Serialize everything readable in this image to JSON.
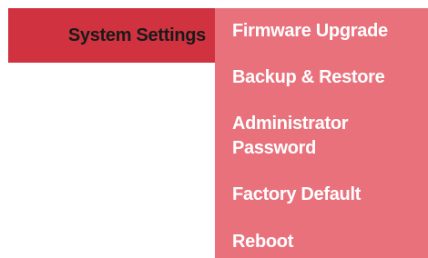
{
  "menu": {
    "main_item": "System Settings",
    "submenu": [
      {
        "label": "Firmware Upgrade"
      },
      {
        "label": "Backup & Restore"
      },
      {
        "label": "Administrator Password"
      },
      {
        "label": "Factory Default"
      },
      {
        "label": "Reboot"
      }
    ]
  },
  "colors": {
    "main_item_bg": "#d0323f",
    "submenu_bg": "#e8717c",
    "submenu_text": "#ffffff",
    "main_item_text": "#1a1a1a"
  }
}
